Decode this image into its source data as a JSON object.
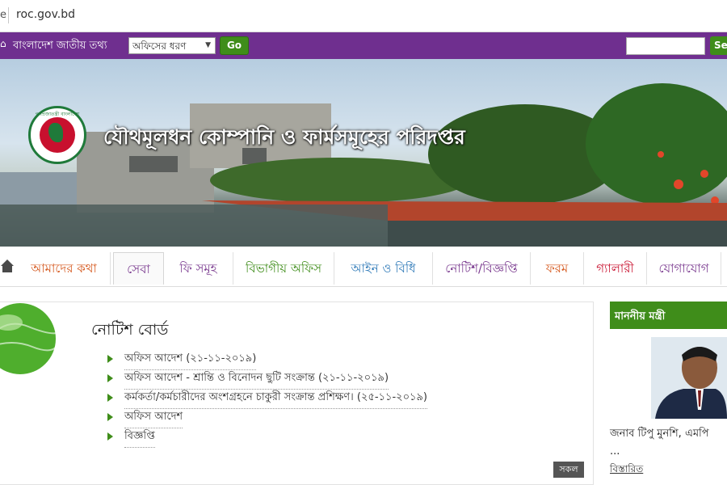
{
  "browser": {
    "tab_fragment": "e",
    "url": "roc.gov.bd"
  },
  "top_strip": {
    "portal_label": "বাংলাদেশ জাতীয় তথ্য",
    "office_select": {
      "value": "অফিসের ধরণ"
    },
    "go_label": "Go",
    "search_placeholder": "",
    "search_button_fragment": "Se"
  },
  "banner": {
    "title": "যৌথমূলধন কোম্পানি ও ফার্মসমূহের পরিদপ্তর",
    "emblem_text": "গণপ্রজাতন্ত্রী বাংলাদেশ সরকার"
  },
  "nav": {
    "items": [
      {
        "label": "আমাদের কথা",
        "color": "#d5571c"
      },
      {
        "label": "সেবা",
        "color": "#7a3a8f"
      },
      {
        "label": "ফি সমূহ",
        "color": "#7a3a8f"
      },
      {
        "label": "বিভাগীয় অফিস",
        "color": "#3f8d1a"
      },
      {
        "label": "আইন ও বিধি",
        "color": "#2f7ab8"
      },
      {
        "label": "নোটিশ/বিজ্ঞপ্তি",
        "color": "#7a3a8f"
      },
      {
        "label": "ফরম",
        "color": "#d5571c"
      },
      {
        "label": "গ্যালারী",
        "color": "#c8102e"
      },
      {
        "label": "যোগাযোগ",
        "color": "#7a3a8f"
      }
    ]
  },
  "notice_board": {
    "title": "নোটিশ বোর্ড",
    "items": [
      "অফিস আদেশ (২১-১১-২০১৯)",
      "অফিস আদেশ - শ্রান্তি ও বিনোদন ছুটি সংক্রান্ত (২১-১১-২০১৯)",
      "কর্মকর্তা/কর্মচারীদের অংশগ্রহনে চাকুরী সংক্রান্ত প্রশিক্ষণ। (২৫-১১-২০১৯)",
      "অফিস আদেশ",
      "বিজ্ঞপ্তি"
    ],
    "all_label": "সকল"
  },
  "sidebar": {
    "heading": "মাননীয় মন্ত্রী",
    "minister_name": "জনাব টিপু মুনশি, এমপি",
    "ellipsis": "...",
    "details_label": "বিস্তারিত"
  },
  "colors": {
    "purple": "#6f2f8f",
    "green": "#3f8d1a"
  }
}
